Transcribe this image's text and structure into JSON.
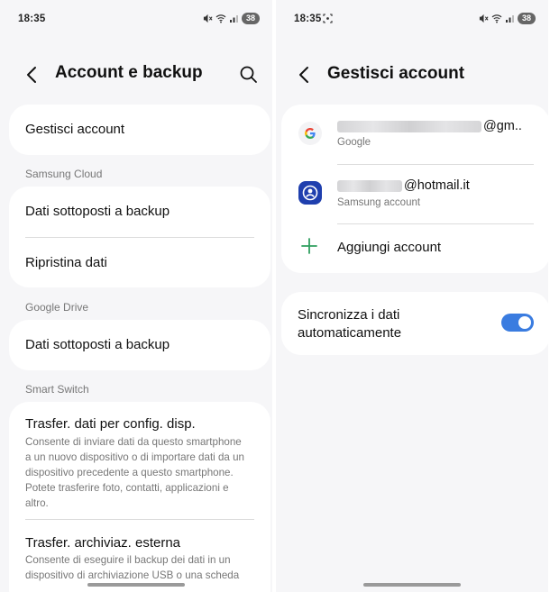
{
  "left": {
    "status": {
      "time": "18:35",
      "battery": "38"
    },
    "header": {
      "title": "Account e backup"
    },
    "manage_accounts": "Gestisci account",
    "samsung_cloud": {
      "section": "Samsung Cloud",
      "items": [
        "Dati sottoposti a backup",
        "Ripristina dati"
      ]
    },
    "google_drive": {
      "section": "Google Drive",
      "items": [
        "Dati sottoposti a backup"
      ]
    },
    "smart_switch": {
      "section": "Smart Switch",
      "items": [
        {
          "title": "Trasfer. dati per config. disp.",
          "lines": [
            "Consente di inviare dati da questo smartphone",
            "a un nuovo dispositivo o di importare dati da un",
            "dispositivo precedente a questo smartphone.",
            "Potete trasferire foto, contatti, applicazioni e",
            "altro."
          ]
        },
        {
          "title": "Trasfer. archiviaz. esterna",
          "lines": [
            "Consente di eseguire il backup dei dati in un",
            "dispositivo di archiviazione USB o una scheda"
          ]
        }
      ]
    }
  },
  "right": {
    "status": {
      "time": "18:35",
      "battery": "38"
    },
    "header": {
      "title": "Gestisci account"
    },
    "accounts": [
      {
        "email_suffix": "@gm..",
        "type": "Google",
        "icon": "google-icon"
      },
      {
        "email_suffix": "@hotmail.it",
        "type": "Samsung account",
        "icon": "samsung-account-icon"
      }
    ],
    "add_account": "Aggiungi account",
    "auto_sync": {
      "lines": [
        "Sincronizza i dati",
        "automaticamente"
      ],
      "enabled": true
    },
    "colors": {
      "toggle": "#3a7ce0",
      "add_icon": "#2f9e5f",
      "samsung_icon": "#1f3fae"
    }
  }
}
